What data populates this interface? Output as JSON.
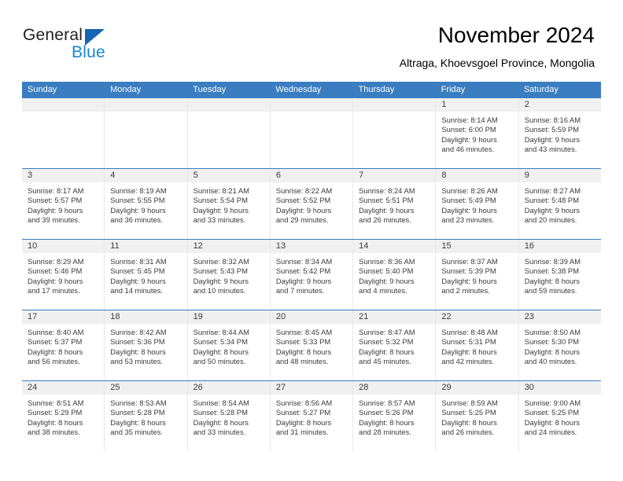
{
  "brand": {
    "name_part1": "General",
    "name_part2": "Blue",
    "triangle_color": "#1565b0",
    "blue_color": "#1884d4"
  },
  "header": {
    "title": "November 2024",
    "subtitle": "Altraga, Khoevsgoel Province, Mongolia"
  },
  "theme": {
    "header_row_bg": "#3a7dc0",
    "day_band_bg": "#f0f0f0",
    "text_color": "#3b3b3b"
  },
  "weekdays": [
    "Sunday",
    "Monday",
    "Tuesday",
    "Wednesday",
    "Thursday",
    "Friday",
    "Saturday"
  ],
  "weeks": [
    [
      {
        "day": "",
        "sunrise": "",
        "sunset": "",
        "daylight_line1": "",
        "daylight_line2": ""
      },
      {
        "day": "",
        "sunrise": "",
        "sunset": "",
        "daylight_line1": "",
        "daylight_line2": ""
      },
      {
        "day": "",
        "sunrise": "",
        "sunset": "",
        "daylight_line1": "",
        "daylight_line2": ""
      },
      {
        "day": "",
        "sunrise": "",
        "sunset": "",
        "daylight_line1": "",
        "daylight_line2": ""
      },
      {
        "day": "",
        "sunrise": "",
        "sunset": "",
        "daylight_line1": "",
        "daylight_line2": ""
      },
      {
        "day": "1",
        "sunrise": "Sunrise: 8:14 AM",
        "sunset": "Sunset: 6:00 PM",
        "daylight_line1": "Daylight: 9 hours",
        "daylight_line2": "and 46 minutes."
      },
      {
        "day": "2",
        "sunrise": "Sunrise: 8:16 AM",
        "sunset": "Sunset: 5:59 PM",
        "daylight_line1": "Daylight: 9 hours",
        "daylight_line2": "and 43 minutes."
      }
    ],
    [
      {
        "day": "3",
        "sunrise": "Sunrise: 8:17 AM",
        "sunset": "Sunset: 5:57 PM",
        "daylight_line1": "Daylight: 9 hours",
        "daylight_line2": "and 39 minutes."
      },
      {
        "day": "4",
        "sunrise": "Sunrise: 8:19 AM",
        "sunset": "Sunset: 5:55 PM",
        "daylight_line1": "Daylight: 9 hours",
        "daylight_line2": "and 36 minutes."
      },
      {
        "day": "5",
        "sunrise": "Sunrise: 8:21 AM",
        "sunset": "Sunset: 5:54 PM",
        "daylight_line1": "Daylight: 9 hours",
        "daylight_line2": "and 33 minutes."
      },
      {
        "day": "6",
        "sunrise": "Sunrise: 8:22 AM",
        "sunset": "Sunset: 5:52 PM",
        "daylight_line1": "Daylight: 9 hours",
        "daylight_line2": "and 29 minutes."
      },
      {
        "day": "7",
        "sunrise": "Sunrise: 8:24 AM",
        "sunset": "Sunset: 5:51 PM",
        "daylight_line1": "Daylight: 9 hours",
        "daylight_line2": "and 26 minutes."
      },
      {
        "day": "8",
        "sunrise": "Sunrise: 8:26 AM",
        "sunset": "Sunset: 5:49 PM",
        "daylight_line1": "Daylight: 9 hours",
        "daylight_line2": "and 23 minutes."
      },
      {
        "day": "9",
        "sunrise": "Sunrise: 8:27 AM",
        "sunset": "Sunset: 5:48 PM",
        "daylight_line1": "Daylight: 9 hours",
        "daylight_line2": "and 20 minutes."
      }
    ],
    [
      {
        "day": "10",
        "sunrise": "Sunrise: 8:29 AM",
        "sunset": "Sunset: 5:46 PM",
        "daylight_line1": "Daylight: 9 hours",
        "daylight_line2": "and 17 minutes."
      },
      {
        "day": "11",
        "sunrise": "Sunrise: 8:31 AM",
        "sunset": "Sunset: 5:45 PM",
        "daylight_line1": "Daylight: 9 hours",
        "daylight_line2": "and 14 minutes."
      },
      {
        "day": "12",
        "sunrise": "Sunrise: 8:32 AM",
        "sunset": "Sunset: 5:43 PM",
        "daylight_line1": "Daylight: 9 hours",
        "daylight_line2": "and 10 minutes."
      },
      {
        "day": "13",
        "sunrise": "Sunrise: 8:34 AM",
        "sunset": "Sunset: 5:42 PM",
        "daylight_line1": "Daylight: 9 hours",
        "daylight_line2": "and 7 minutes."
      },
      {
        "day": "14",
        "sunrise": "Sunrise: 8:36 AM",
        "sunset": "Sunset: 5:40 PM",
        "daylight_line1": "Daylight: 9 hours",
        "daylight_line2": "and 4 minutes."
      },
      {
        "day": "15",
        "sunrise": "Sunrise: 8:37 AM",
        "sunset": "Sunset: 5:39 PM",
        "daylight_line1": "Daylight: 9 hours",
        "daylight_line2": "and 2 minutes."
      },
      {
        "day": "16",
        "sunrise": "Sunrise: 8:39 AM",
        "sunset": "Sunset: 5:38 PM",
        "daylight_line1": "Daylight: 8 hours",
        "daylight_line2": "and 59 minutes."
      }
    ],
    [
      {
        "day": "17",
        "sunrise": "Sunrise: 8:40 AM",
        "sunset": "Sunset: 5:37 PM",
        "daylight_line1": "Daylight: 8 hours",
        "daylight_line2": "and 56 minutes."
      },
      {
        "day": "18",
        "sunrise": "Sunrise: 8:42 AM",
        "sunset": "Sunset: 5:36 PM",
        "daylight_line1": "Daylight: 8 hours",
        "daylight_line2": "and 53 minutes."
      },
      {
        "day": "19",
        "sunrise": "Sunrise: 8:44 AM",
        "sunset": "Sunset: 5:34 PM",
        "daylight_line1": "Daylight: 8 hours",
        "daylight_line2": "and 50 minutes."
      },
      {
        "day": "20",
        "sunrise": "Sunrise: 8:45 AM",
        "sunset": "Sunset: 5:33 PM",
        "daylight_line1": "Daylight: 8 hours",
        "daylight_line2": "and 48 minutes."
      },
      {
        "day": "21",
        "sunrise": "Sunrise: 8:47 AM",
        "sunset": "Sunset: 5:32 PM",
        "daylight_line1": "Daylight: 8 hours",
        "daylight_line2": "and 45 minutes."
      },
      {
        "day": "22",
        "sunrise": "Sunrise: 8:48 AM",
        "sunset": "Sunset: 5:31 PM",
        "daylight_line1": "Daylight: 8 hours",
        "daylight_line2": "and 42 minutes."
      },
      {
        "day": "23",
        "sunrise": "Sunrise: 8:50 AM",
        "sunset": "Sunset: 5:30 PM",
        "daylight_line1": "Daylight: 8 hours",
        "daylight_line2": "and 40 minutes."
      }
    ],
    [
      {
        "day": "24",
        "sunrise": "Sunrise: 8:51 AM",
        "sunset": "Sunset: 5:29 PM",
        "daylight_line1": "Daylight: 8 hours",
        "daylight_line2": "and 38 minutes."
      },
      {
        "day": "25",
        "sunrise": "Sunrise: 8:53 AM",
        "sunset": "Sunset: 5:28 PM",
        "daylight_line1": "Daylight: 8 hours",
        "daylight_line2": "and 35 minutes."
      },
      {
        "day": "26",
        "sunrise": "Sunrise: 8:54 AM",
        "sunset": "Sunset: 5:28 PM",
        "daylight_line1": "Daylight: 8 hours",
        "daylight_line2": "and 33 minutes."
      },
      {
        "day": "27",
        "sunrise": "Sunrise: 8:56 AM",
        "sunset": "Sunset: 5:27 PM",
        "daylight_line1": "Daylight: 8 hours",
        "daylight_line2": "and 31 minutes."
      },
      {
        "day": "28",
        "sunrise": "Sunrise: 8:57 AM",
        "sunset": "Sunset: 5:26 PM",
        "daylight_line1": "Daylight: 8 hours",
        "daylight_line2": "and 28 minutes."
      },
      {
        "day": "29",
        "sunrise": "Sunrise: 8:59 AM",
        "sunset": "Sunset: 5:25 PM",
        "daylight_line1": "Daylight: 8 hours",
        "daylight_line2": "and 26 minutes."
      },
      {
        "day": "30",
        "sunrise": "Sunrise: 9:00 AM",
        "sunset": "Sunset: 5:25 PM",
        "daylight_line1": "Daylight: 8 hours",
        "daylight_line2": "and 24 minutes."
      }
    ]
  ]
}
